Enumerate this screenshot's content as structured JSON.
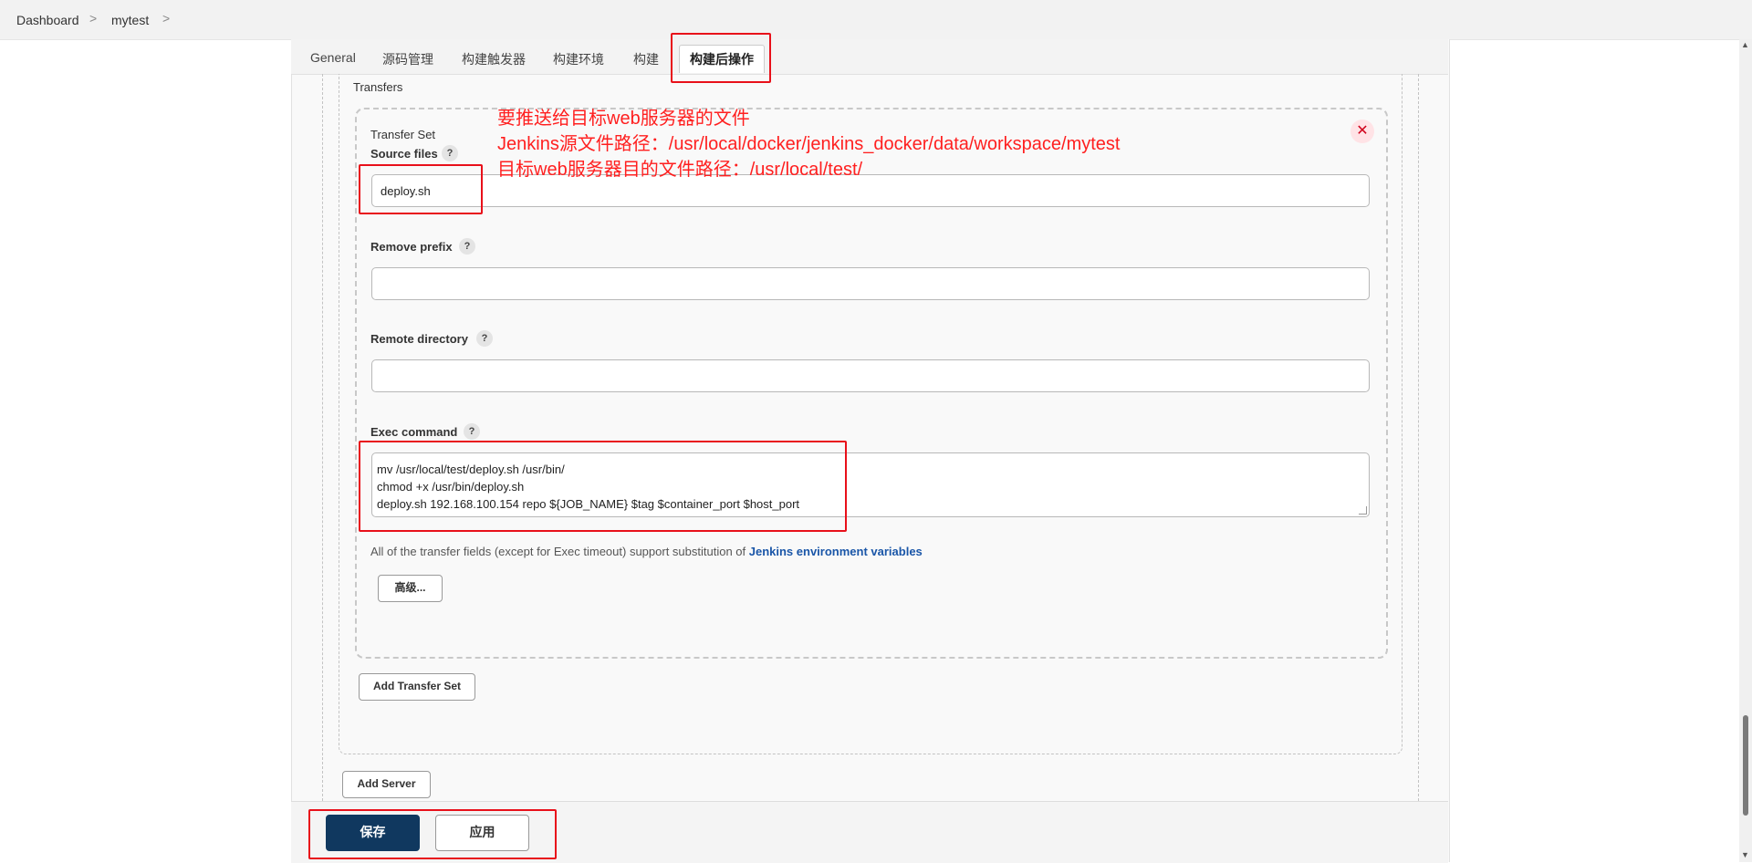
{
  "breadcrumb": {
    "items": [
      {
        "label": "Dashboard"
      },
      {
        "label": "mytest"
      }
    ],
    "separator": ">"
  },
  "tabs": [
    {
      "label": "General"
    },
    {
      "label": "源码管理"
    },
    {
      "label": "构建触发器"
    },
    {
      "label": "构建环境"
    },
    {
      "label": "构建"
    },
    {
      "label": "构建后操作",
      "active": true
    }
  ],
  "section": {
    "transfers_label": "Transfers",
    "transfer_set_label": "Transfer Set",
    "close_symbol": "✕"
  },
  "fields": {
    "source_files": {
      "label": "Source files",
      "help": "?",
      "value": "deploy.sh"
    },
    "remove_prefix": {
      "label": "Remove prefix",
      "help": "?",
      "value": ""
    },
    "remote_directory": {
      "label": "Remote directory",
      "help": "?",
      "value": ""
    },
    "exec_command": {
      "label": "Exec command",
      "help": "?",
      "lines": [
        "mv /usr/local/test/deploy.sh /usr/bin/",
        "chmod +x /usr/bin/deploy.sh",
        "deploy.sh 192.168.100.154 repo ${JOB_NAME} $tag $container_port $host_port"
      ]
    }
  },
  "note": {
    "text": "All of the transfer fields (except for Exec timeout) support substitution of ",
    "link": "Jenkins environment variables"
  },
  "buttons": {
    "advanced": "高级...",
    "add_transfer_set": "Add Transfer Set",
    "add_server": "Add Server",
    "save": "保存",
    "apply": "应用"
  },
  "annotations": {
    "lines": [
      "要推送给目标web服务器的文件",
      "Jenkins源文件路径：/usr/local/docker/jenkins_docker/data/workspace/mytest",
      "目标web服务器目的文件路径：/usr/local/test/"
    ],
    "color": "#ff1f1f"
  },
  "colors": {
    "primary_button": "#10385f",
    "link": "#1a56a8",
    "highlight_box": "#e8101a"
  }
}
